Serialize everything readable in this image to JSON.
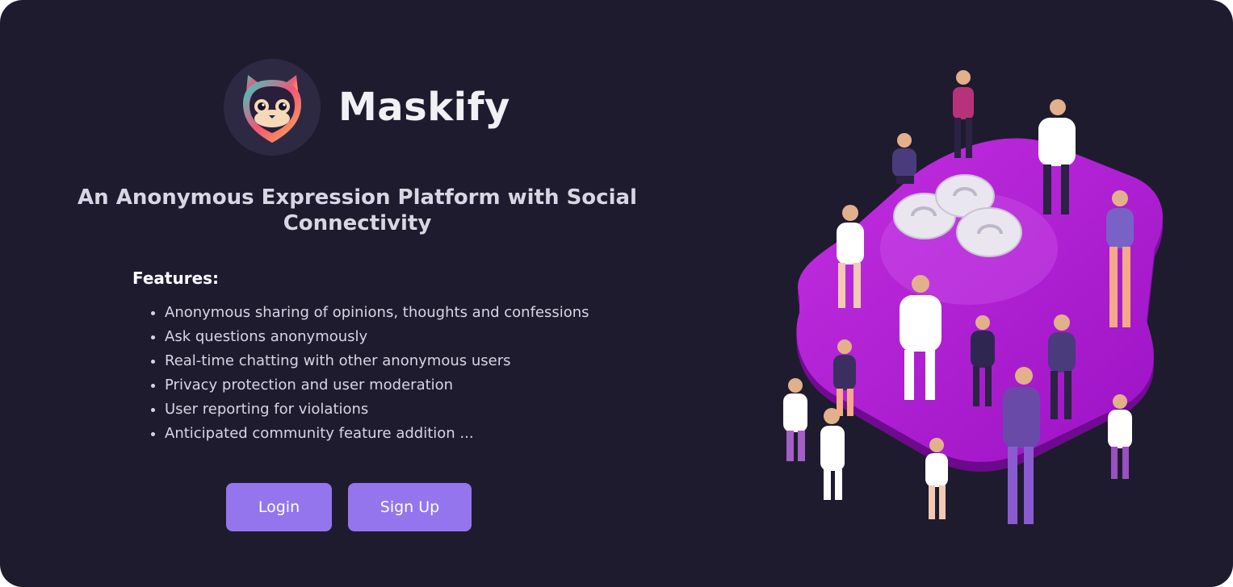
{
  "brand": {
    "name": "Maskify",
    "logo_icon": "masked-cat-logo-icon"
  },
  "hero": {
    "tagline": "An Anonymous Expression Platform with Social Connectivity"
  },
  "features": {
    "heading": "Features:",
    "items": [
      "Anonymous sharing of opinions, thoughts and confessions",
      "Ask questions anonymously",
      "Real-time chatting with other anonymous users",
      "Privacy protection and user moderation",
      "User reporting for violations",
      "Anticipated community feature addition ..."
    ]
  },
  "actions": {
    "login_label": "Login",
    "signup_label": "Sign Up"
  },
  "illustration": {
    "icon": "community-people-illustration"
  },
  "colors": {
    "background": "#1f1b2f",
    "accent": "#9575ee",
    "platform": "#b51fd6"
  }
}
